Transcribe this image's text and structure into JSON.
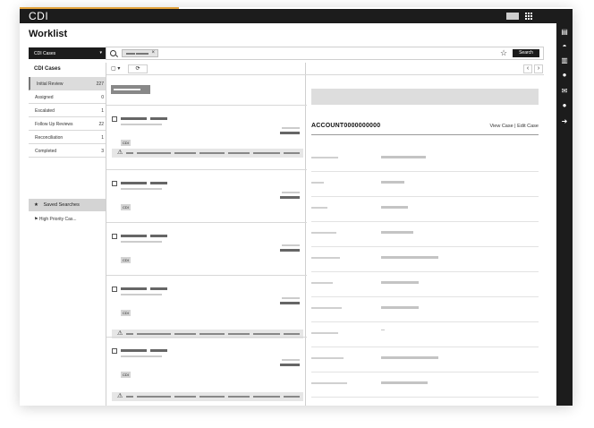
{
  "app": {
    "brand": "CDI",
    "page_title": "Worklist"
  },
  "topbar": {
    "icons": [
      "user-chip-icon",
      "apps-grid-icon"
    ]
  },
  "right_rail": {
    "icons": [
      "document-icon",
      "dashboard-icon",
      "bar-chart-icon",
      "circle-icon",
      "mail-icon",
      "user-icon",
      "logout-icon"
    ]
  },
  "left_panel": {
    "dropdown_label": "CDI Cases",
    "dropdown_caret": "▾",
    "section_title": "CDI Cases",
    "items": [
      {
        "label": "Initial Review",
        "count": "227",
        "active": true
      },
      {
        "label": "Assigned",
        "count": "0"
      },
      {
        "label": "Escalated",
        "count": "1"
      },
      {
        "label": "Follow Up Reviews",
        "count": "22"
      },
      {
        "label": "Reconciliation",
        "count": "1"
      },
      {
        "label": "Completed",
        "count": "3"
      }
    ],
    "saved_searches_label": "Saved Searches",
    "saved_star": "★",
    "saved_items": [
      {
        "label": "High Priority Cas...",
        "flag": "⚑"
      }
    ]
  },
  "search": {
    "chip_remove": "×",
    "favorite_icon": "☆",
    "button_label": "Search"
  },
  "list": {
    "select_label": "▢ ▾",
    "refresh_icon": "⟳",
    "cards": [
      {
        "tag": "CDI",
        "warning": true
      },
      {
        "tag": "CDI",
        "warning": false
      },
      {
        "tag": "CDI",
        "warning": false
      },
      {
        "tag": "CDI",
        "warning": true
      },
      {
        "tag": "CDI",
        "warning": true
      }
    ],
    "warning_icon": "⚠"
  },
  "detail": {
    "prev_icon": "‹",
    "next_icon": "›",
    "account": "ACCOUNT0000000000",
    "links": "View Case | Edit Case",
    "rows": [
      {
        "value": "bar"
      },
      {
        "value": "bar"
      },
      {
        "value": "bar"
      },
      {
        "value": "bar"
      },
      {
        "value": "bar"
      },
      {
        "value": "bar"
      },
      {
        "value": "bar"
      },
      {
        "value": "dash",
        "text": "--"
      },
      {
        "value": "bar"
      },
      {
        "value": "bar"
      }
    ]
  }
}
